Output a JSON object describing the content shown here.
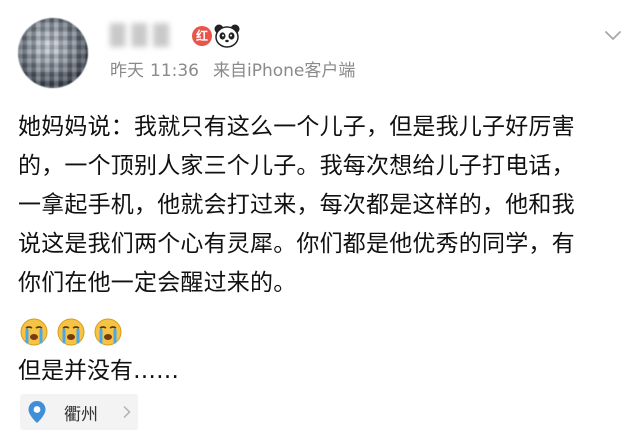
{
  "user": {
    "name": "█ █ █",
    "badge": "红"
  },
  "meta": {
    "day": "昨天",
    "time": "11:36",
    "source": "来自iPhone客户端"
  },
  "post": {
    "lines": [
      "她妈妈说：我就只有这么一个儿子，但是我儿子好厉害",
      "的，一个顶别人家三个儿子。我每次想给儿子打电话，",
      "一拿起手机，他就会打过来，每次都是这样的，他和我",
      "说这是我们两个心有灵犀。你们都是他优秀的同学，有",
      "你们在他一定会醒过来的。"
    ],
    "emojis": [
      "crying-emoji",
      "crying-emoji",
      "crying-emoji"
    ],
    "followup": "但是并没有……"
  },
  "location": {
    "label": "衢州",
    "icon": "location-pin-icon"
  },
  "colors": {
    "meta_text": "#8a8a8a",
    "badge_red": "#e8554b",
    "pin_blue": "#3f8fd8",
    "tag_bg": "#f3f3f3"
  }
}
